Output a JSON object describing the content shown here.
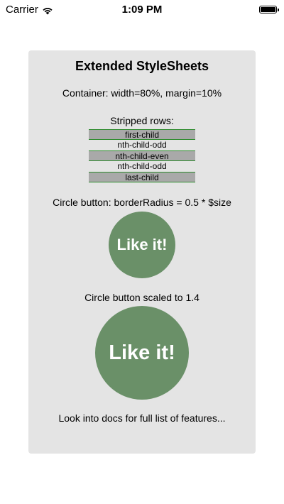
{
  "status_bar": {
    "carrier": "Carrier",
    "time": "1:09 PM",
    "wifi_icon": "wifi-icon",
    "battery_icon": "battery-icon"
  },
  "container": {
    "title": "Extended StyleSheets",
    "container_info": "Container: width=80%, margin=10%",
    "stripped_rows_label": "Stripped rows:",
    "rows": [
      "first-child",
      "nth-child-odd",
      "nth-child-even",
      "nth-child-odd",
      "last-child"
    ],
    "circle_label": "Circle button: borderRadius = 0.5 * $size",
    "circle_button_label": "Like it!",
    "scaled_label": "Circle button scaled to 1.4",
    "scaled_button_label": "Like it!",
    "footer": "Look into docs for full list of features..."
  },
  "colors": {
    "container_bg": "#e4e4e4",
    "row_odd_bg": "#a9a9a9",
    "row_border": "#2e8b2e",
    "button_bg": "#6a9068",
    "button_text": "#ffffff"
  }
}
